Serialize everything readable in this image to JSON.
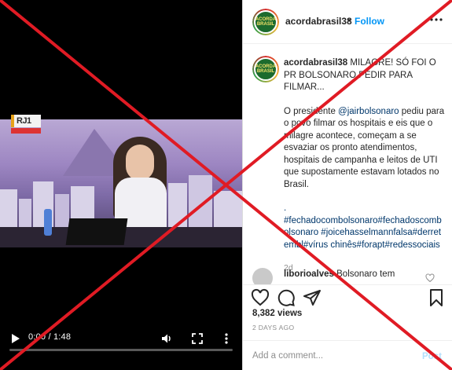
{
  "video": {
    "channel_badge": "RJ1",
    "time_display": "0:00 / 1:48",
    "progress": 0.0,
    "icons": {
      "play": "play-icon",
      "volume": "volume-icon",
      "fullscreen": "fullscreen-icon",
      "more": "more-vertical-icon"
    }
  },
  "header": {
    "username": "acordabrasil38",
    "separator": "•",
    "follow_label": "Follow",
    "more_icon": "more-horizontal-icon"
  },
  "caption": {
    "username": "acordabrasil38",
    "title": "MILAGRE! SÓ FOI O PR BOLSONARO PEDIR PARA FILMAR...",
    "body_before_mention": "O presidente ",
    "mention": "@jairbolsonaro",
    "body_after_mention": " pediu para o povo filmar os hospitais e eis que o milagre acontece, começam a se esvaziar os pronto atendimentos, hospitais de campanha e leitos de UTI que supostamente estavam lotados no Brasil.",
    "dot": ".",
    "hashtags": "#fechadocombolsonaro#fechadoscombolsonaro #joicehasselmannfalsa#derretembl#vírus chinês#forapt#redessociais",
    "age": "2d"
  },
  "comment": {
    "username": "liborioalves",
    "text": "Bolsonaro tem"
  },
  "actions": {
    "like_icon": "heart-icon",
    "comment_icon": "comment-icon",
    "share_icon": "share-icon",
    "save_icon": "bookmark-icon"
  },
  "stats": {
    "views": "8,382 views",
    "date": "2 DAYS AGO"
  },
  "add_comment": {
    "placeholder": "Add a comment...",
    "post_label": "Post"
  },
  "overlay": {
    "mark": "red-x-icon",
    "color": "#e01b24"
  }
}
